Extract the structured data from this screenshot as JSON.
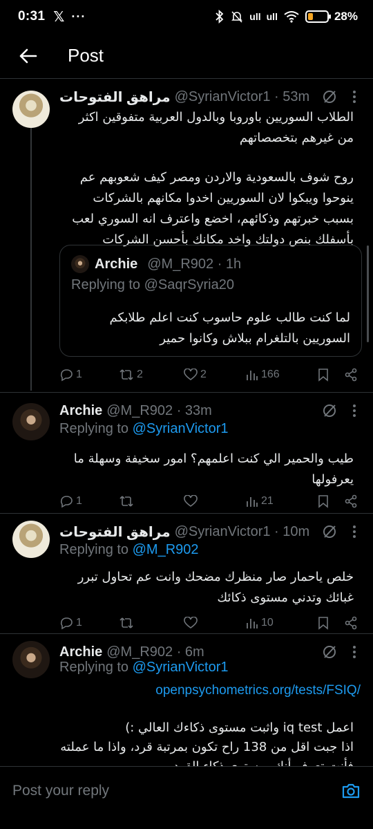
{
  "status_bar": {
    "time": "0:31",
    "x_logo": "𝕏",
    "more": "···",
    "signal_1": "ull",
    "signal_2": "ull",
    "battery_pct": "28%",
    "battery_level": 0.28,
    "battery_color": "#f5a623"
  },
  "header": {
    "title": "Post",
    "back_icon": "arrow-left-icon"
  },
  "posts": [
    {
      "name": "مراهق الفتوحات",
      "meta": "@SyrianVictor1 · 53m",
      "body_1": "الطلاب السوريين باوروبا وبالدول العربية متفوقين اكثر من غيرهم بتخصصاتهم",
      "body_2": "روح شوف بالسعودية والاردن ومصر كيف شعوبهم عم ينوحوا ويبكوا لان السوريين اخدوا مكانهم بالشركات بسبب خبرتهم وذكائهم، اخضع واعترف انه السوري لعب بأسفلك بنص دولتك واخد مكانك بأحسن الشركات",
      "quote": {
        "name": "Archie",
        "meta": "@M_R902 · 1h",
        "replying": "Replying to @SaqrSyria20",
        "body": "لما كنت طالب علوم حاسوب كنت اعلم طلابكم السوريين بالتلغرام ببلاش وكانوا حمير"
      },
      "replies": "1",
      "reposts": "2",
      "likes": "2",
      "views": "166"
    },
    {
      "name": "Archie",
      "meta": "@M_R902 · 33m",
      "replying_prefix": "Replying to ",
      "replying_handle": "@SyrianVictor1",
      "body": "طيب والحمير الي كنت اعلمهم؟ امور سخيفة وسهلة ما يعرفولها",
      "replies": "1",
      "reposts": "",
      "likes": "",
      "views": "21"
    },
    {
      "name": "مراهق الفتوحات",
      "meta": "@SyrianVictor1 · 10m",
      "replying_prefix": "Replying to ",
      "replying_handle": "@M_R902",
      "body": "خلص ياحمار صار منظرك مضحك وانت عم تحاول تبرر غبائك وتدني مستوى ذكائك",
      "replies": "1",
      "reposts": "",
      "likes": "",
      "views": "10"
    },
    {
      "name": "Archie",
      "meta": "@M_R902 · 6m",
      "replying_prefix": "Replying to ",
      "replying_handle": "@SyrianVictor1",
      "link": "openpsychometrics.org/tests/FSIQ/",
      "body_1": "اعمل iq test واثبت مستوى ذكاءك العالي :)",
      "body_2": "اذا جبت اقل من 138 راح تكون بمرتبة قرد، واذا ما عملته",
      "body_3": "فأنت تعرف أنك بمستوى ذكاء القرد"
    }
  ],
  "reply_bar": {
    "placeholder": "Post your reply",
    "camera_icon": "camera-icon",
    "accent": "#1d9bf0"
  }
}
